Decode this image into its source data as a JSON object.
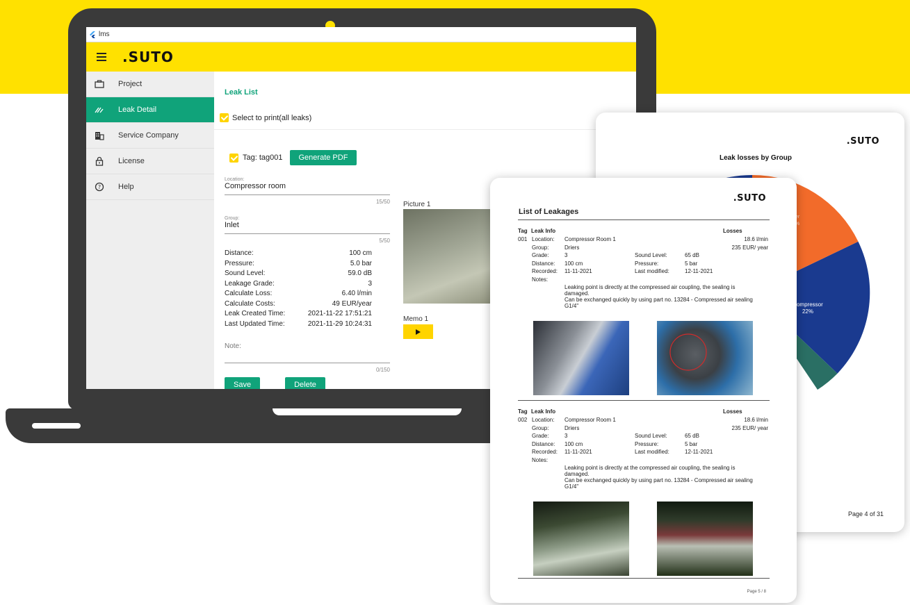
{
  "window": {
    "title": "lms"
  },
  "app_bar": {
    "logo": ".SUTO"
  },
  "sidebar": {
    "items": [
      {
        "label": "Project",
        "icon": "briefcase-icon",
        "active": false
      },
      {
        "label": "Leak Detail",
        "icon": "leak-icon",
        "active": true
      },
      {
        "label": "Service Company",
        "icon": "building-icon",
        "active": false
      },
      {
        "label": "License",
        "icon": "lock-icon",
        "active": false
      },
      {
        "label": "Help",
        "icon": "help-icon",
        "active": false
      }
    ]
  },
  "leak_detail": {
    "title": "Leak List",
    "select_all_label": "Select to print(all leaks)",
    "tag_label": "Tag: tag001",
    "generate_pdf_label": "Generate PDF",
    "location": {
      "label": "Location:",
      "value": "Compressor room",
      "counter": "15/50"
    },
    "group": {
      "label": "Group:",
      "value": "Inlet",
      "counter": "5/50"
    },
    "info": [
      {
        "key": "Distance:",
        "value": "100 cm"
      },
      {
        "key": "Pressure:",
        "value": "5.0 bar"
      },
      {
        "key": "Sound Level:",
        "value": "59.0 dB"
      },
      {
        "key": "Leakage Grade:",
        "value": "3"
      },
      {
        "key": "Calculate Loss:",
        "value": "6.40 l/min"
      },
      {
        "key": "Calculate Costs:",
        "value": "49 EUR/year"
      },
      {
        "key": "Leak Created Time:",
        "value": "2021-11-22 17:51:21"
      },
      {
        "key": "Last Updated Time:",
        "value": "2021-11-29 10:24:31"
      }
    ],
    "note": {
      "label": "Note:",
      "counter": "0/150"
    },
    "save_label": "Save",
    "delete_label": "Delete",
    "picture_label": "Picture 1",
    "memo_label": "Memo 1"
  },
  "pie_report": {
    "logo": ".SUTO",
    "title": "Leak losses by Group",
    "slices": [
      {
        "label": "Compressor",
        "pct_label": "22%",
        "color": "#1a3a8f"
      },
      {
        "label": "",
        "pct_label": "",
        "color": "#f26b2a"
      },
      {
        "label": "",
        "pct_label": "",
        "color": "#2a6f64"
      }
    ],
    "hidden_label_fragments": [
      "er",
      "%"
    ],
    "footer": "Page 4 of 31",
    "colors": {
      "navy": "#1a3a8f",
      "orange": "#f26b2a",
      "teal": "#2a6f64"
    }
  },
  "leak_report": {
    "logo": ".SUTO",
    "title": "List of Leakages",
    "header": {
      "tag": "Tag",
      "info": "Leak Info",
      "losses": "Losses"
    },
    "entries": [
      {
        "tag": "001",
        "location_key": "Location:",
        "location": "Compressor Room 1",
        "group_key": "Group:",
        "group": "Driers",
        "grade_key": "Grade:",
        "grade": "3",
        "sound_key": "Sound Level:",
        "sound": "65 dB",
        "distance_key": "Distance:",
        "distance": "100 cm",
        "pressure_key": "Pressure:",
        "pressure": "5 bar",
        "recorded_key": "Recorded:",
        "recorded": "11-11-2021",
        "modified_key": "Last modified:",
        "modified": "12-11-2021",
        "notes_key": "Notes:",
        "notes": [
          "Leaking point is directly at the compressed air coupling, the sealing is",
          "damaged.",
          "Can be exchanged quickly by using part no. 13284 - Compressed air sealing",
          "G1/4\""
        ],
        "loss_flow": "18.6  l/min",
        "loss_cost": "235  EUR/ year"
      },
      {
        "tag": "002",
        "location_key": "Location:",
        "location": "Compressor Room 1",
        "group_key": "Group:",
        "group": "Driers",
        "grade_key": "Grade:",
        "grade": "3",
        "sound_key": "Sound Level:",
        "sound": "65 dB",
        "distance_key": "Distance:",
        "distance": "100 cm",
        "pressure_key": "Pressure:",
        "pressure": "5 bar",
        "recorded_key": "Recorded:",
        "recorded": "11-11-2021",
        "modified_key": "Last modified:",
        "modified": "12-11-2021",
        "notes_key": "Notes:",
        "notes": [
          "Leaking point is directly at the compressed air coupling, the sealing is",
          "damaged.",
          "Can be exchanged quickly by using part no. 13284 - Compressed air sealing",
          "G1/4\""
        ],
        "loss_flow": "18.6  l/min",
        "loss_cost": "235  EUR/ year"
      }
    ],
    "footer": "Page 5 / 8"
  },
  "colors": {
    "brand_yellow": "#ffe100",
    "accent_green": "#10a37a",
    "laptop": "#3a3a3a"
  }
}
